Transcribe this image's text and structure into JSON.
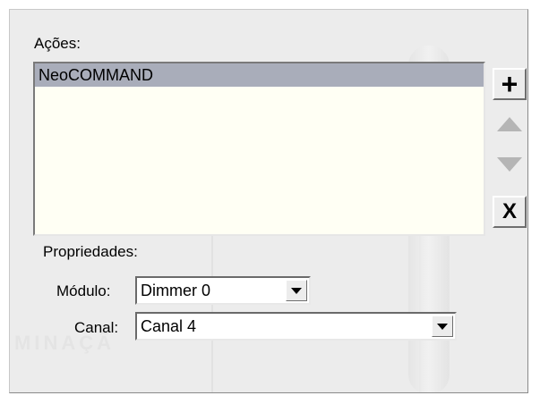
{
  "actions": {
    "label": "Ações:",
    "items": [
      "NeoCOMMAND"
    ]
  },
  "buttons": {
    "add": "+",
    "remove": "X"
  },
  "properties": {
    "label": "Propriedades:",
    "module_label": "Módulo:",
    "module_value": "Dimmer 0",
    "channel_label": "Canal:",
    "channel_value": "Canal 4"
  },
  "icons": {
    "add": "plus-icon",
    "up": "arrow-up-icon",
    "down": "arrow-down-icon",
    "remove": "x-icon",
    "dropdown": "chevron-down-icon"
  },
  "colors": {
    "panel": "#ececec",
    "list_background": "#fffff4",
    "selection": "#a9adba",
    "disabled_arrow": "#b5b5b5"
  },
  "watermark": "MINAÇÃ"
}
